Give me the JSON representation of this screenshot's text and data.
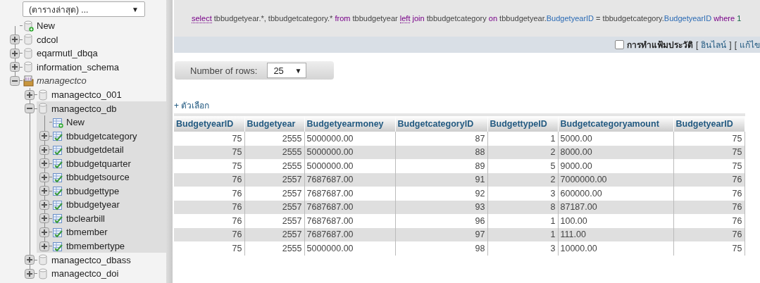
{
  "sidebar": {
    "table_filter": {
      "value": "(ตารางล่าสุด) ...",
      "arrow": "▼"
    },
    "tree": [
      {
        "label": "New",
        "kind": "new-db"
      },
      {
        "label": "cdcol",
        "kind": "db",
        "expanded": false
      },
      {
        "label": "eqarmutl_dbqa",
        "kind": "db",
        "expanded": false
      },
      {
        "label": "information_schema",
        "kind": "db",
        "expanded": false
      },
      {
        "label": "managectco",
        "kind": "group",
        "expanded": true,
        "children": [
          {
            "label": "managectco_001",
            "kind": "db",
            "expanded": false
          },
          {
            "label": "managectco_db",
            "kind": "db",
            "expanded": true,
            "selected": true,
            "children": [
              {
                "label": "New",
                "kind": "new-table"
              },
              {
                "label": "tbbudgetcategory",
                "kind": "table",
                "expanded": false
              },
              {
                "label": "tbbudgetdetail",
                "kind": "table",
                "expanded": false
              },
              {
                "label": "tbbudgetquarter",
                "kind": "table",
                "expanded": false
              },
              {
                "label": "tbbudgetsource",
                "kind": "table",
                "expanded": false
              },
              {
                "label": "tbbudgettype",
                "kind": "table",
                "expanded": false
              },
              {
                "label": "tbbudgetyear",
                "kind": "table",
                "expanded": false
              },
              {
                "label": "tbclearbill",
                "kind": "table",
                "expanded": false
              },
              {
                "label": "tbmember",
                "kind": "table",
                "expanded": false
              },
              {
                "label": "tbmembertype",
                "kind": "table",
                "expanded": false
              }
            ]
          },
          {
            "label": "managectco_dbass",
            "kind": "db",
            "expanded": false
          },
          {
            "label": "managectco_doi",
            "kind": "db",
            "expanded": false
          }
        ]
      }
    ]
  },
  "query": {
    "sql": [
      {
        "kind": "keyword-abbr",
        "text": "select"
      },
      {
        "kind": "plain",
        "text": " tbbudgetyear.*, tbbudgetcategory.* "
      },
      {
        "kind": "keyword",
        "text": "from"
      },
      {
        "kind": "plain",
        "text": " tbbudgetyear "
      },
      {
        "kind": "keyword-abbr",
        "text": "left"
      },
      {
        "kind": "keyword",
        "text": " join"
      },
      {
        "kind": "plain",
        "text": " tbbudgetcategory "
      },
      {
        "kind": "keyword",
        "text": "on"
      },
      {
        "kind": "plain",
        "text": " tbbudgetyear."
      },
      {
        "kind": "column",
        "text": "BudgetyearID"
      },
      {
        "kind": "plain",
        "text": " = tbbudgetcategory."
      },
      {
        "kind": "column",
        "text": "BudgetyearID"
      },
      {
        "kind": "keyword",
        "text": " where"
      },
      {
        "kind": "number",
        "text": " 1"
      }
    ]
  },
  "profiling": {
    "checked": false,
    "label": "การทำแฟ้มประวัติ",
    "items": [
      {
        "kind": "bracket",
        "text": "["
      },
      {
        "kind": "link",
        "text": "อินไลน์"
      },
      {
        "kind": "bracket",
        "text": "]"
      },
      {
        "kind": "bracket",
        "text": "["
      },
      {
        "kind": "link",
        "text": "แก้ไข"
      }
    ]
  },
  "rows_control": {
    "label": "Number of rows:",
    "value": "25",
    "arrow": "▼"
  },
  "options_link": "+ ตัวเลือก",
  "table": {
    "columns": [
      {
        "label": "BudgetyearID",
        "kind": "number"
      },
      {
        "label": "Budgetyear",
        "kind": "number"
      },
      {
        "label": "Budgetyearmoney",
        "kind": "text"
      },
      {
        "label": "BudgetcategoryID",
        "kind": "number"
      },
      {
        "label": "BudgettypeID",
        "kind": "number"
      },
      {
        "label": "Budgetcategoryamount",
        "kind": "text"
      },
      {
        "label": "BudgetyearID",
        "kind": "number"
      }
    ],
    "rows": [
      [
        "75",
        "2555",
        "5000000.00",
        "87",
        "1",
        "5000.00",
        "75"
      ],
      [
        "75",
        "2555",
        "5000000.00",
        "88",
        "2",
        "8000.00",
        "75"
      ],
      [
        "75",
        "2555",
        "5000000.00",
        "89",
        "5",
        "9000.00",
        "75"
      ],
      [
        "76",
        "2557",
        "7687687.00",
        "91",
        "2",
        "7000000.00",
        "76"
      ],
      [
        "76",
        "2557",
        "7687687.00",
        "92",
        "3",
        "600000.00",
        "76"
      ],
      [
        "76",
        "2557",
        "7687687.00",
        "93",
        "8",
        "87187.00",
        "76"
      ],
      [
        "76",
        "2557",
        "7687687.00",
        "96",
        "1",
        "100.00",
        "76"
      ],
      [
        "76",
        "2557",
        "7687687.00",
        "97",
        "1",
        "111.00",
        "76"
      ],
      [
        "75",
        "2555",
        "5000000.00",
        "98",
        "3",
        "10000.00",
        "75"
      ]
    ]
  }
}
